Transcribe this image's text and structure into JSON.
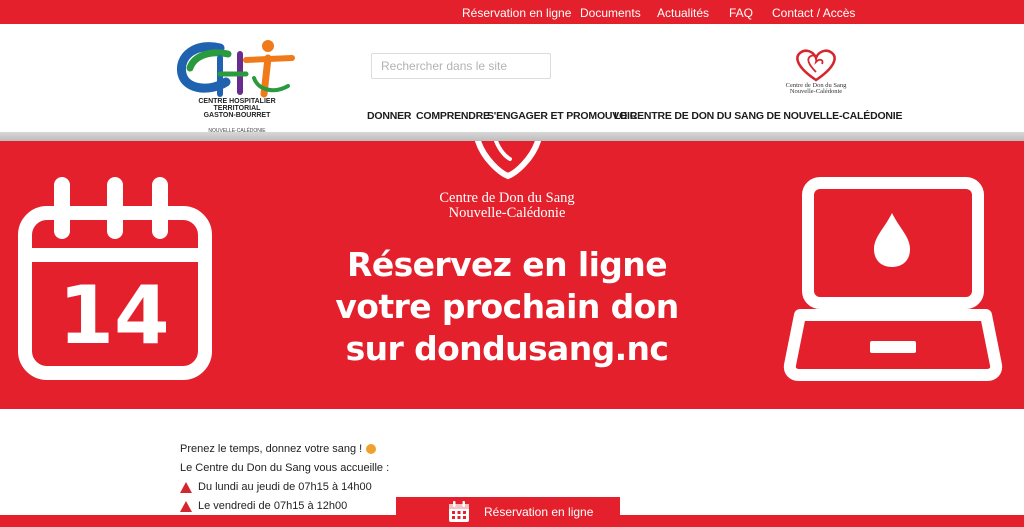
{
  "topnav": {
    "reservation": "Réservation en ligne",
    "documents": "Documents",
    "actualites": "Actualités",
    "faq": "FAQ",
    "contact": "Contact / Accès"
  },
  "logo": {
    "line1": "CENTRE HOSPITALIER TERRITORIAL",
    "line2": "GASTON-BOURRET",
    "line3": "NOUVELLE-CALÉDONIE"
  },
  "search": {
    "placeholder": "Rechercher dans le site"
  },
  "mainnav": {
    "donner": "DONNER",
    "comprendre": "COMPRENDRE",
    "engager": "S'ENGAGER ET PROMOUVOIR",
    "centre": "LE CENTRE DE DON DU SANG DE NOUVELLE-CALÉDONIE"
  },
  "cds_logo": {
    "line1": "Centre de Don du Sang",
    "line2": "Nouvelle-Calédonie"
  },
  "banner": {
    "org_line1": "Centre de Don du Sang",
    "org_line2": "Nouvelle-Calédonie",
    "headline_line1": "Réservez en ligne",
    "headline_line2": "votre prochain don",
    "headline_line3": "sur dondusang.nc",
    "calendar_day": "14"
  },
  "content": {
    "line1": "Prenez le temps, donnez votre sang !",
    "line2": "Le Centre du Don du Sang vous accueille :",
    "line3": "Du lundi au jeudi de 07h15 à 14h00",
    "line4": "Le vendredi de 07h15 à 12h00"
  },
  "bottom_button": {
    "label": "Réservation en ligne"
  },
  "colors": {
    "brand_red": "#e3202b",
    "white": "#ffffff"
  },
  "icons": [
    "heart-logo-icon",
    "calendar-icon",
    "laptop-blood-drop-icon",
    "warning-triangle-icon",
    "heart-eyes-emoji-icon",
    "calendar-small-icon"
  ]
}
